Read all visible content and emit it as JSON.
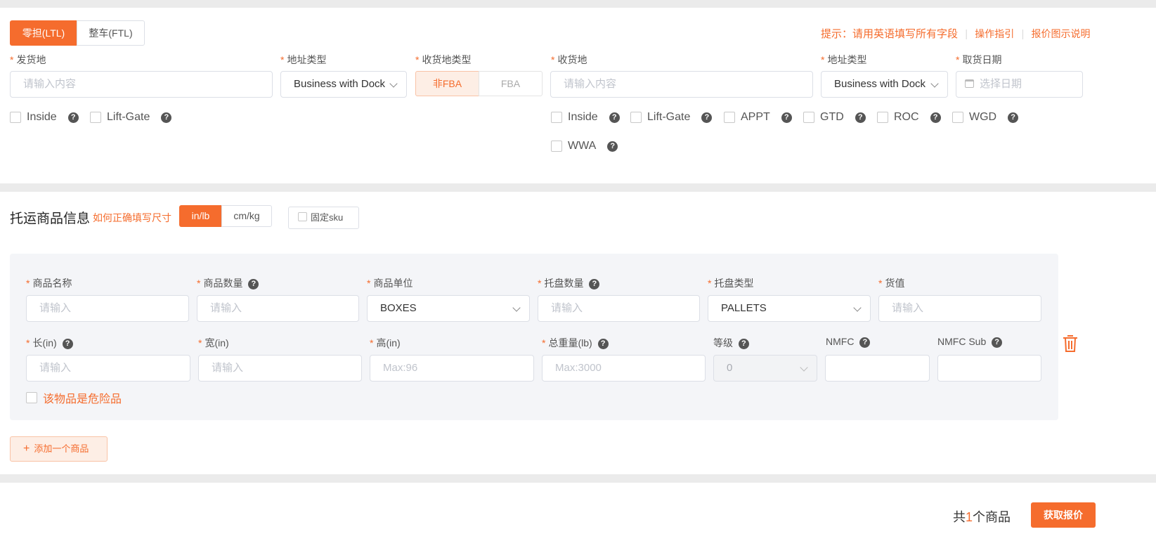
{
  "mode_tabs": [
    "零担(LTL)",
    "整车(FTL)"
  ],
  "header_links": {
    "tip": "提示：请用英语填写所有字段",
    "guide": "操作指引",
    "quote_explain": "报价图示说明"
  },
  "shipper": {
    "origin_label": "发货地",
    "origin_placeholder": "请输入内容",
    "addr_type_label": "地址类型",
    "addr_type_value": "Business with Dock",
    "dest_type_label": "收货地类型",
    "dest_type_options": [
      "非FBA",
      "FBA"
    ],
    "dest_label": "收货地",
    "dest_placeholder": "请输入内容",
    "dest_addr_type_label": "地址类型",
    "dest_addr_type_value": "Business with Dock",
    "pickup_label": "取货日期",
    "pickup_placeholder": "选择日期"
  },
  "origin_options": [
    "Inside",
    "Lift-Gate"
  ],
  "dest_options": [
    "Inside",
    "Lift-Gate",
    "APPT",
    "GTD",
    "ROC",
    "WGD",
    "WWA"
  ],
  "goods": {
    "title": "托运商品信息",
    "size_help": "如何正确填写尺寸",
    "units": [
      "in/lb",
      "cm/kg"
    ],
    "fixed_sku": "固定sku",
    "row1": [
      {
        "label": "商品名称",
        "placeholder": "请输入",
        "req": true,
        "q": false
      },
      {
        "label": "商品数量",
        "placeholder": "请输入",
        "req": true,
        "q": true
      },
      {
        "label": "商品单位",
        "value": "BOXES",
        "req": true,
        "q": false
      },
      {
        "label": "托盘数量",
        "placeholder": "请输入",
        "req": true,
        "q": true
      },
      {
        "label": "托盘类型",
        "value": "PALLETS",
        "req": true,
        "q": false
      },
      {
        "label": "货值",
        "placeholder": "请输入",
        "req": true,
        "q": false
      }
    ],
    "row2": [
      {
        "label": "长(in)",
        "placeholder": "请输入",
        "req": true,
        "q": true
      },
      {
        "label": "宽(in)",
        "placeholder": "请输入",
        "req": true,
        "q": false
      },
      {
        "label": "高(in)",
        "placeholder": "Max:96",
        "req": true,
        "q": false
      },
      {
        "label": "总重量(lb)",
        "placeholder": "Max:3000",
        "req": true,
        "q": true
      },
      {
        "label": "等级",
        "value": "0",
        "req": false,
        "q": true
      },
      {
        "label": "NMFC",
        "placeholder": "",
        "req": false,
        "q": true
      },
      {
        "label": "NMFC Sub",
        "placeholder": "",
        "req": false,
        "q": true
      }
    ],
    "dangerous": "该物品是危险品",
    "add_item": "添加一个商品"
  },
  "footer": {
    "total_prefix": "共",
    "total_count": "1",
    "total_suffix": "个商品",
    "get_quote": "获取报价"
  },
  "colors": {
    "accent": "#f56c2d"
  }
}
